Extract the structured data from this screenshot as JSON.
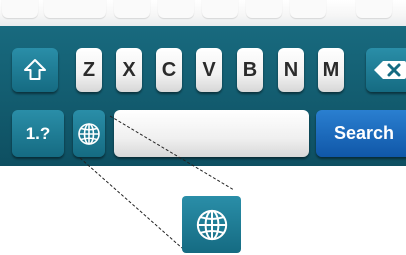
{
  "keyboard": {
    "letters": [
      "Z",
      "X",
      "C",
      "V",
      "B",
      "N",
      "M"
    ],
    "numbers_key_label": "1.?",
    "search_key_label": "Search",
    "space_key_label": ""
  },
  "icons": {
    "shift": "shift-icon",
    "backspace": "backspace-icon",
    "globe": "globe-icon"
  },
  "colors": {
    "keyboard_background": "#0e4f61",
    "function_key": "#1a7d96",
    "search_key": "#1a6cc0",
    "letter_key": "#f1f1f1"
  }
}
